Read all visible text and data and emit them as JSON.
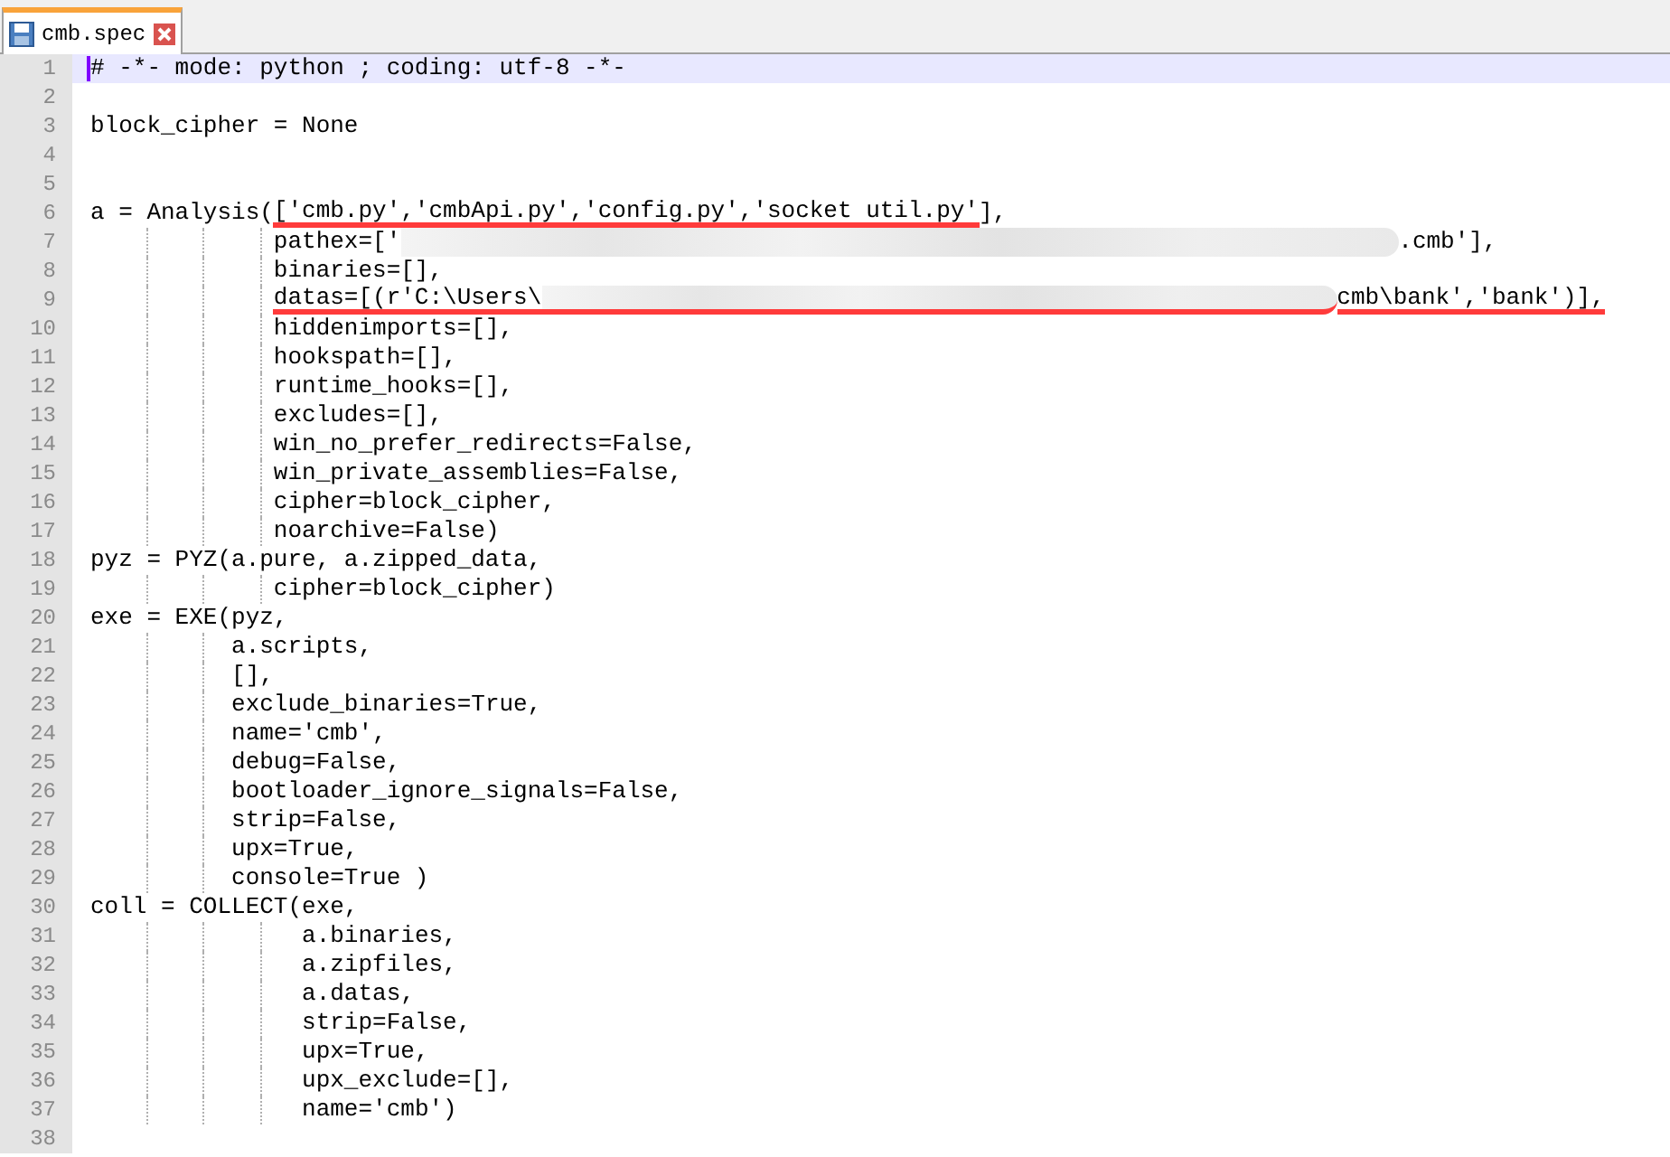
{
  "tabs": [
    {
      "label": "cmb.spec",
      "selected": true
    }
  ],
  "lines": [
    {
      "number": "1",
      "current": true,
      "text": "# -*- mode: python ; coding: utf-8 -*-"
    },
    {
      "number": "2",
      "current": false
    },
    {
      "number": "3",
      "current": false,
      "text": "block_cipher = None"
    },
    {
      "number": "4",
      "current": false
    },
    {
      "number": "5",
      "current": false
    },
    {
      "number": "6",
      "current": false,
      "segments": [
        {
          "kind": "code",
          "text": "a = Analysis(",
          "underlined": false
        },
        {
          "kind": "code",
          "text": "['cmb.py','cmbApi.py','config.py','socket util.py'",
          "underlined": true
        },
        {
          "kind": "code",
          "text": "],",
          "underlined": false
        }
      ]
    },
    {
      "number": "7",
      "current": false,
      "segments": [
        {
          "kind": "code",
          "text": "             pathex=['",
          "underlined": false
        },
        {
          "kind": "redacted",
          "underlined": false
        },
        {
          "kind": "code",
          "text": ".cmb'],",
          "underlined": false
        }
      ]
    },
    {
      "number": "8",
      "current": false,
      "text": "             binaries=[],"
    },
    {
      "number": "9",
      "current": false,
      "segments": [
        {
          "kind": "code",
          "text": "             datas=[(r'C:\\Users\\",
          "underlined": true
        },
        {
          "kind": "redacted",
          "underlined": true
        },
        {
          "kind": "code",
          "text": "cmb\\bank','bank')],",
          "underlined": true
        }
      ]
    },
    {
      "number": "10",
      "current": false,
      "text": "             hiddenimports=[],"
    },
    {
      "number": "11",
      "current": false,
      "text": "             hookspath=[],"
    },
    {
      "number": "12",
      "current": false,
      "text": "             runtime_hooks=[],"
    },
    {
      "number": "13",
      "current": false,
      "text": "             excludes=[],"
    },
    {
      "number": "14",
      "current": false,
      "text": "             win_no_prefer_redirects=False,"
    },
    {
      "number": "15",
      "current": false,
      "text": "             win_private_assemblies=False,"
    },
    {
      "number": "16",
      "current": false,
      "text": "             cipher=block_cipher,"
    },
    {
      "number": "17",
      "current": false,
      "text": "             noarchive=False)"
    },
    {
      "number": "18",
      "current": false,
      "text": "pyz = PYZ(a.pure, a.zipped_data,"
    },
    {
      "number": "19",
      "current": false,
      "text": "             cipher=block_cipher)"
    },
    {
      "number": "20",
      "current": false,
      "text": "exe = EXE(pyz,"
    },
    {
      "number": "21",
      "current": false,
      "text": "          a.scripts,"
    },
    {
      "number": "22",
      "current": false,
      "text": "          [],"
    },
    {
      "number": "23",
      "current": false,
      "text": "          exclude_binaries=True,"
    },
    {
      "number": "24",
      "current": false,
      "text": "          name='cmb',"
    },
    {
      "number": "25",
      "current": false,
      "text": "          debug=False,"
    },
    {
      "number": "26",
      "current": false,
      "text": "          bootloader_ignore_signals=False,"
    },
    {
      "number": "27",
      "current": false,
      "text": "          strip=False,"
    },
    {
      "number": "28",
      "current": false,
      "text": "          upx=True,"
    },
    {
      "number": "29",
      "current": false,
      "text": "          console=True )"
    },
    {
      "number": "30",
      "current": false,
      "text": "coll = COLLECT(exe,"
    },
    {
      "number": "31",
      "current": false,
      "text": "               a.binaries,"
    },
    {
      "number": "32",
      "current": false,
      "text": "               a.zipfiles,"
    },
    {
      "number": "33",
      "current": false,
      "text": "               a.datas,"
    },
    {
      "number": "34",
      "current": false,
      "text": "               strip=False,"
    },
    {
      "number": "35",
      "current": false,
      "text": "               upx=True,"
    },
    {
      "number": "36",
      "current": false,
      "text": "               upx_exclude=[],"
    },
    {
      "number": "37",
      "current": false,
      "text": "               name='cmb')"
    },
    {
      "number": "38",
      "current": false
    }
  ]
}
